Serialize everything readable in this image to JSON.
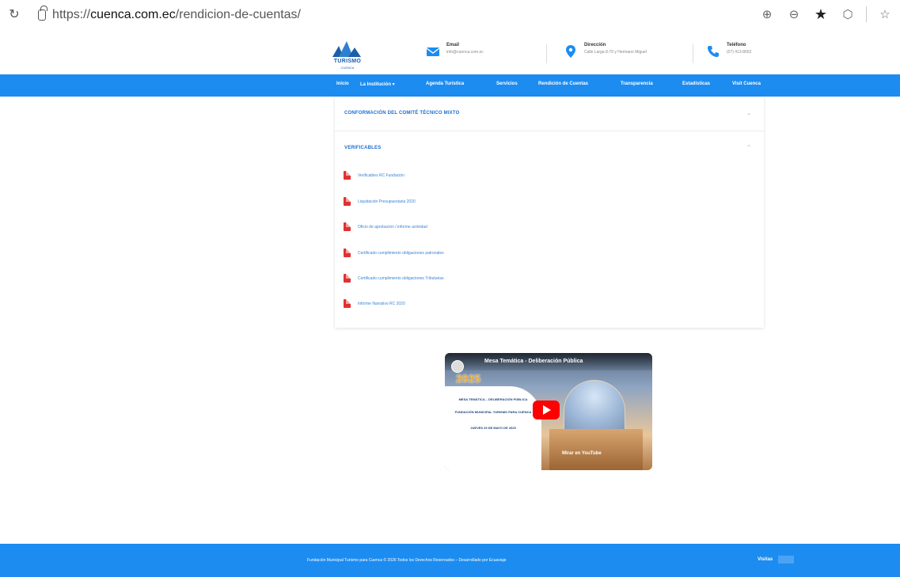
{
  "browser": {
    "url_prefix": "https://",
    "url_host": "cuenca.com.ec",
    "url_path": "/rendicion-de-cuentas/"
  },
  "header": {
    "logo_text": "TURISMO",
    "logo_sub": "CUENCA",
    "email_title": "Email",
    "email_value": "info@cuenca.com.ec",
    "address_title": "Dirección",
    "address_value": "Calle Larga 8-79 y Hermano Miguel",
    "phone_title": "Teléfono",
    "phone_value": "(07) 413-8652"
  },
  "nav": {
    "items": [
      "Inicio",
      "La Institución",
      "Agenda Turística",
      "Servicios",
      "Rendición de Cuentas",
      "Transparencia",
      "Estadísticas",
      "Visit Cuenca"
    ]
  },
  "accordion": {
    "section1_title": "CONFORMACIÓN DEL COMITÉ TÉCNICO MIXTO",
    "section2_title": "VERIFICABLES",
    "documents": [
      "Verificables RC Fundación",
      "Liquidación Presupuestaria 2020",
      "Oficio de aprobación / informe actividad",
      "Certificado cumplimiento obligaciones patronales",
      "Certificado cumplimiento obligaciones Tributarias",
      "Informe Narrativo RC 2020"
    ]
  },
  "video": {
    "title": "Mesa Temática - Deliberación Pública",
    "year": "2025",
    "line1": "MESA TEMÁTICA – DELIBERACIÓN PÚBLICA",
    "line2": "FUNDACIÓN MUNICIPAL TURISMO PARA CUENCA",
    "line3": "JUEVES 29 DE MAYO DE 2025",
    "watch_label": "Mirar en YouTube"
  },
  "footer": {
    "text": "Fundación Municipal Turismo para Cuenca © 2026 Todos los Derechos Reservados – Desarrollado por Ecuaviaje",
    "visitas_label": "Visitas"
  },
  "colors": {
    "primary": "#1c8cf0",
    "link": "#3a84d6",
    "pdf": "#e03131"
  }
}
